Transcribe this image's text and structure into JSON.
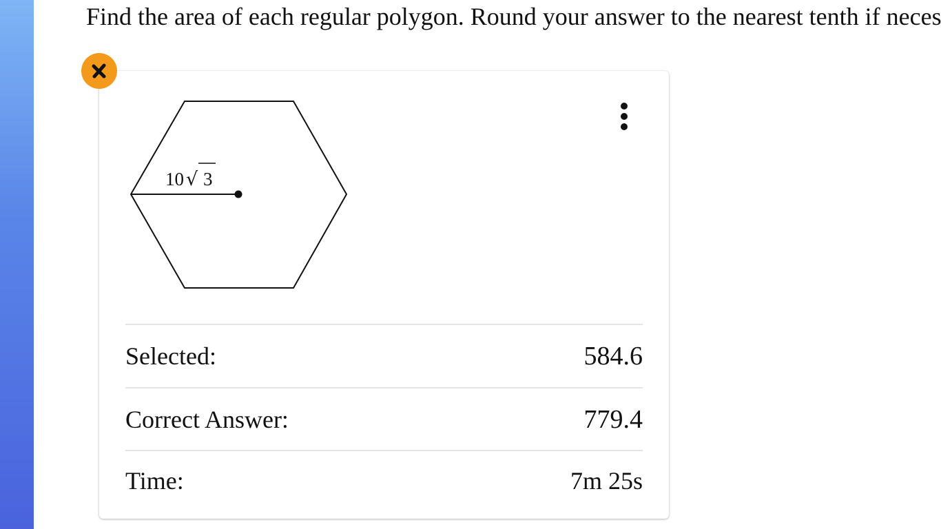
{
  "question": {
    "prompt": "Find the area of each regular polygon.  Round your answer to the nearest tenth if necessary."
  },
  "figure": {
    "shape": "regular hexagon",
    "measure_label_coefficient": "10",
    "measure_label_radicand": "3",
    "measure_label_symbol": "√"
  },
  "result": {
    "status_icon": "close-icon",
    "status_color": "#f39a1c",
    "selected_label": "Selected:",
    "selected_value": "584.6",
    "correct_label": "Correct Answer:",
    "correct_value": "779.4",
    "time_label": "Time:",
    "time_value": "7m 25s"
  },
  "menu": {
    "icon": "more-vertical-icon"
  }
}
